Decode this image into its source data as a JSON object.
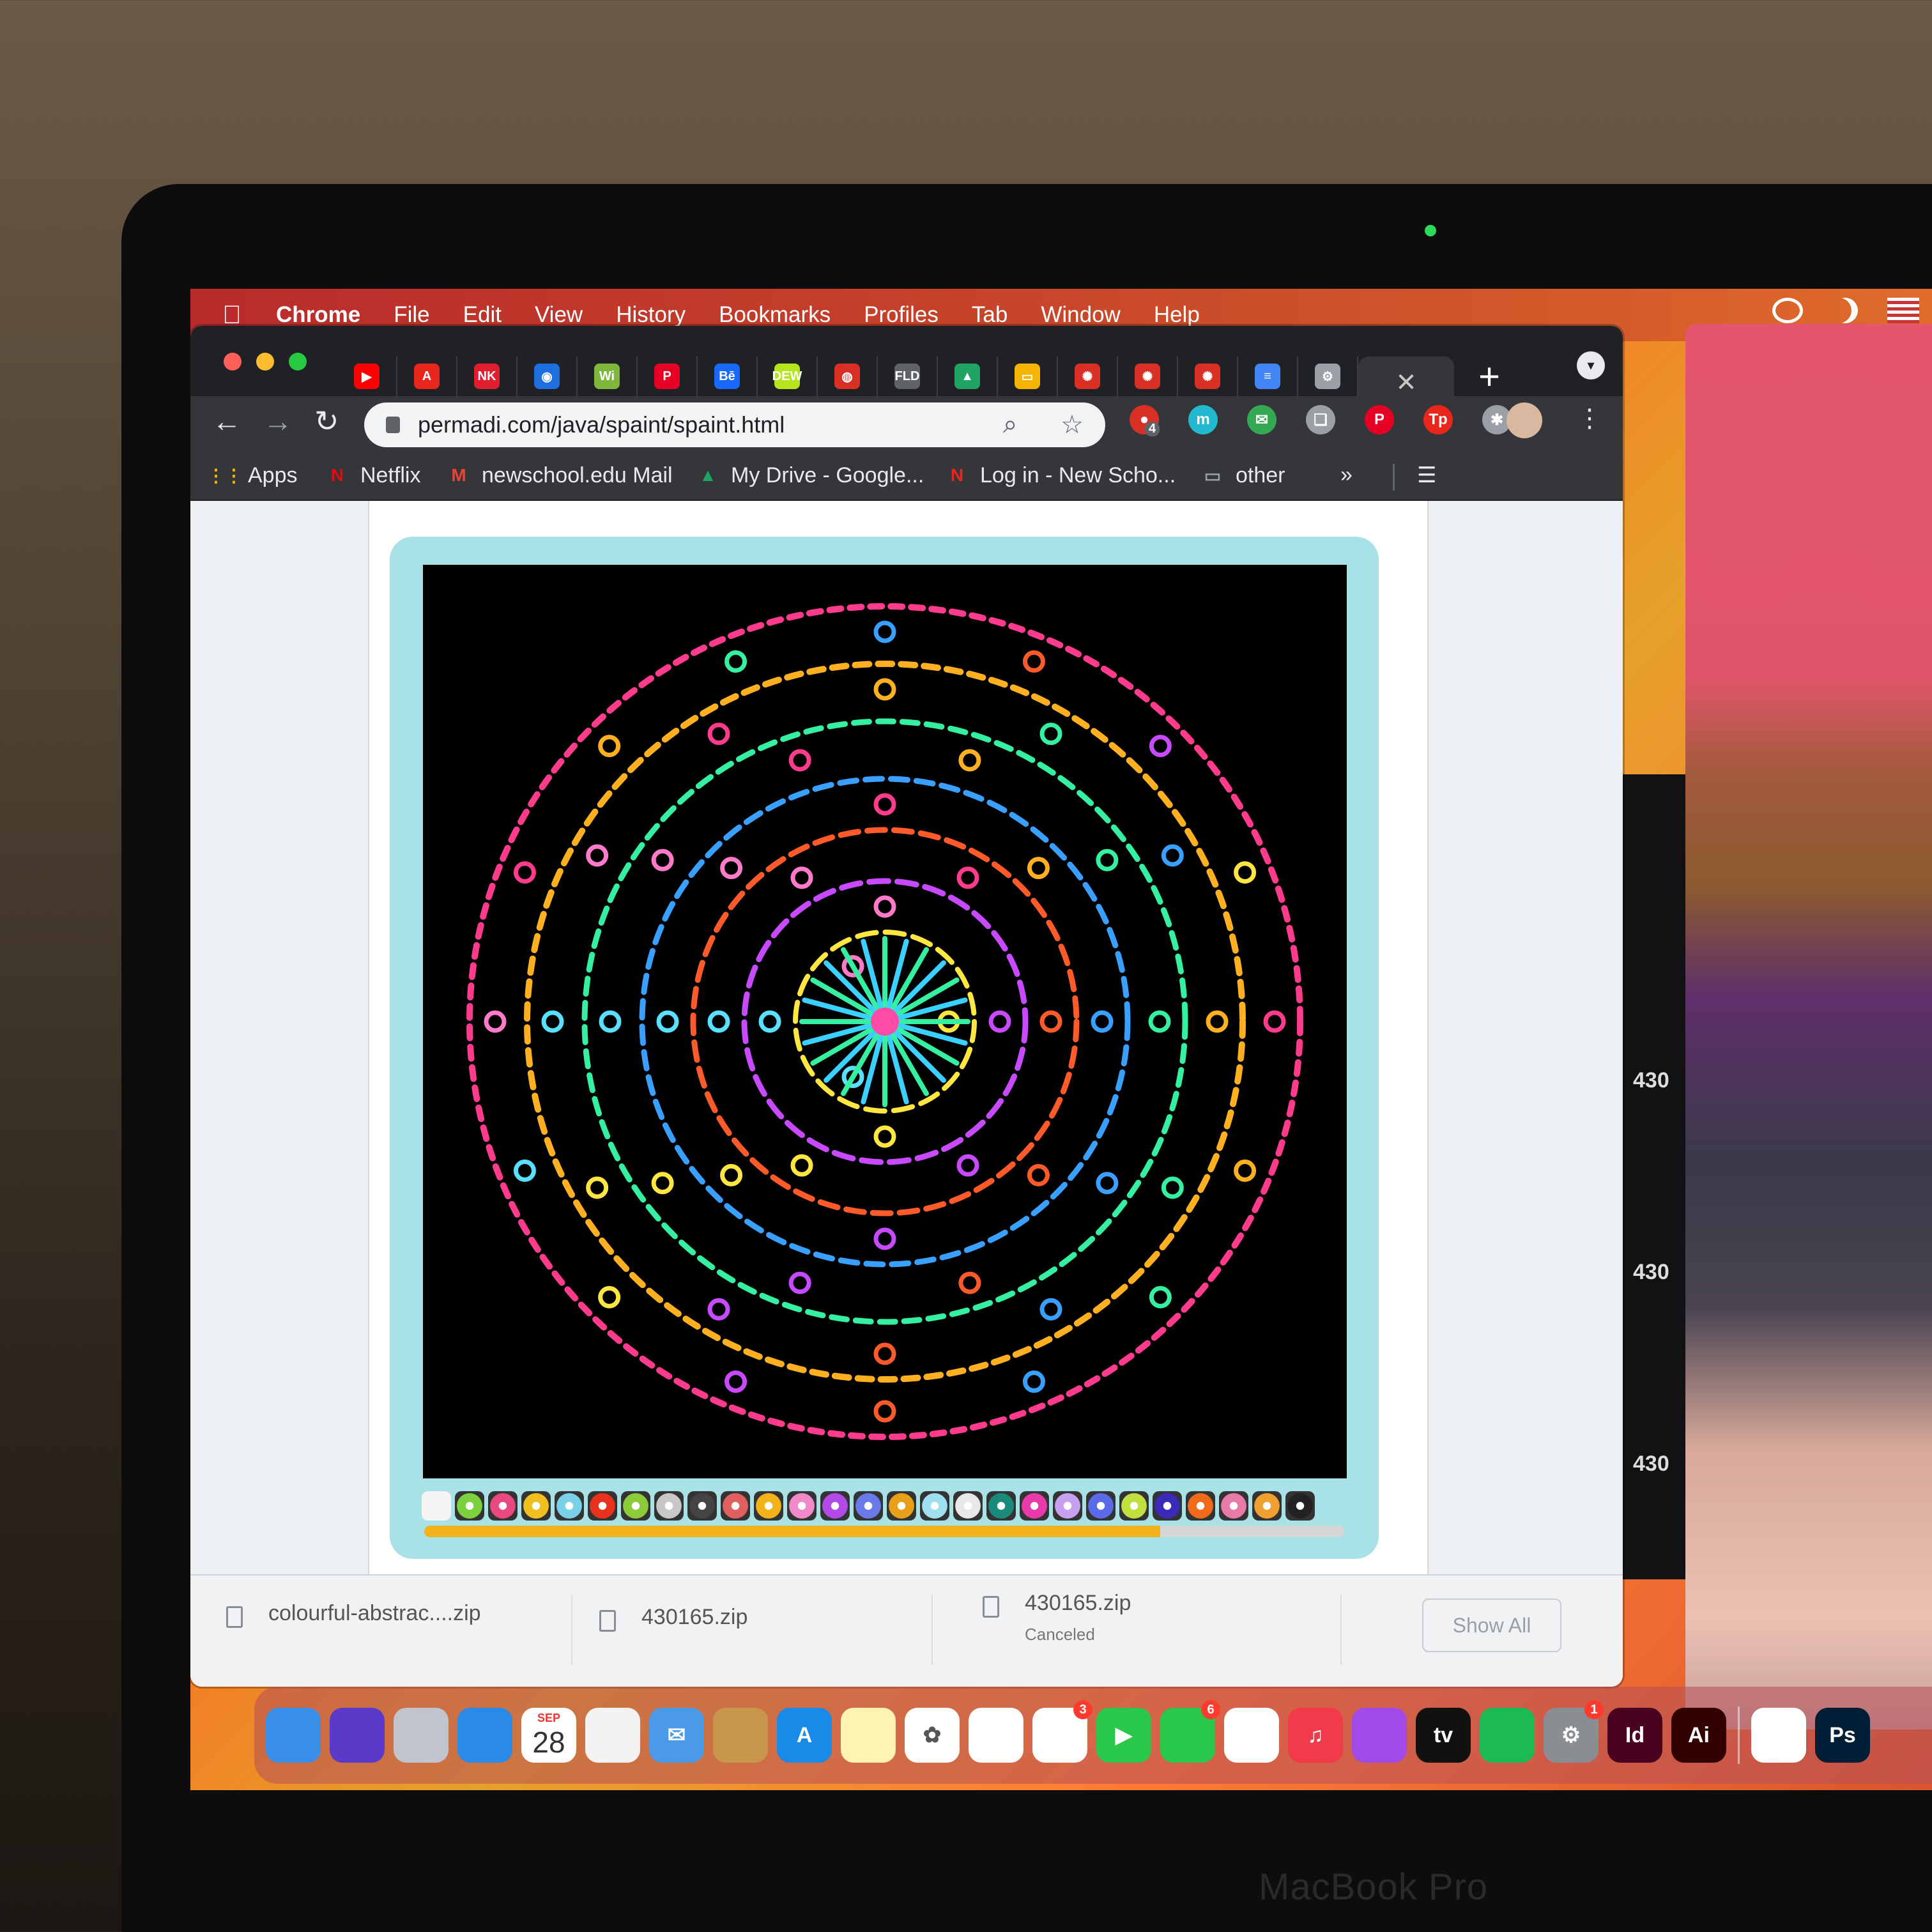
{
  "menubar": {
    "apple": "",
    "app_name": "Chrome",
    "items": [
      "File",
      "Edit",
      "View",
      "History",
      "Bookmarks",
      "Profiles",
      "Tab",
      "Window",
      "Help"
    ]
  },
  "tabs": {
    "favicons": [
      {
        "icon": "youtube-icon",
        "color": "#ff0000",
        "glyph": "▶"
      },
      {
        "icon": "adobe-icon",
        "color": "#e8261c",
        "glyph": "A"
      },
      {
        "icon": "nk-icon",
        "color": "#e01e2f",
        "glyph": "NK"
      },
      {
        "icon": "blue-circle-icon",
        "color": "#1d6fe0",
        "glyph": "◉"
      },
      {
        "icon": "wi-icon",
        "color": "#7fb63c",
        "glyph": "Wi"
      },
      {
        "icon": "pinterest-icon",
        "color": "#e60023",
        "glyph": "P"
      },
      {
        "icon": "behance-icon",
        "color": "#1769ff",
        "glyph": "Bē"
      },
      {
        "icon": "dew-icon",
        "color": "#b5e61d",
        "glyph": "DEW"
      },
      {
        "icon": "globe-icon",
        "color": "#d93025",
        "glyph": "◍"
      },
      {
        "icon": "fld-icon",
        "color": "#5f6368",
        "glyph": "FLD"
      },
      {
        "icon": "google-drive-icon",
        "color": "#1fa463",
        "glyph": "▲"
      },
      {
        "icon": "google-slides-icon",
        "color": "#f4b400",
        "glyph": "▭"
      },
      {
        "icon": "spiral-icon",
        "color": "#d93025",
        "glyph": "✺"
      },
      {
        "icon": "spiral-icon",
        "color": "#d93025",
        "glyph": "✺"
      },
      {
        "icon": "spiral-icon",
        "color": "#d93025",
        "glyph": "✺"
      },
      {
        "icon": "google-docs-icon",
        "color": "#4285f4",
        "glyph": "≡"
      },
      {
        "icon": "settings-icon",
        "color": "#9aa0a6",
        "glyph": "⚙"
      }
    ],
    "active_close": "✕",
    "new_tab": "+"
  },
  "toolbar": {
    "url": "permadi.com/java/spaint/spaint.html",
    "extension_badge": "4",
    "extensions": [
      {
        "icon": "extension-red-icon",
        "color": "#d93025",
        "glyph": "●"
      },
      {
        "icon": "extension-m-icon",
        "color": "#22b8cf",
        "glyph": "m"
      },
      {
        "icon": "extension-mail-icon",
        "color": "#34a853",
        "glyph": "✉"
      },
      {
        "icon": "extension-book-icon",
        "color": "#9aa0a6",
        "glyph": "❏"
      },
      {
        "icon": "pinterest-icon",
        "color": "#e60023",
        "glyph": "P"
      },
      {
        "icon": "extension-tp-icon",
        "color": "#e8261c",
        "glyph": "Tp"
      },
      {
        "icon": "puzzle-icon",
        "color": "#9aa0a6",
        "glyph": "✱"
      }
    ]
  },
  "bookmarks": [
    {
      "label": "Apps",
      "icon": "apps-grid-icon",
      "glyph": "⋮⋮",
      "color": "#f4b400"
    },
    {
      "label": "Netflix",
      "icon": "netflix-icon",
      "glyph": "N",
      "color": "#e50914"
    },
    {
      "label": "newschool.edu Mail",
      "icon": "gmail-icon",
      "glyph": "M",
      "color": "#ea4335"
    },
    {
      "label": "My Drive - Google...",
      "icon": "google-drive-icon",
      "glyph": "▲",
      "color": "#1fa463"
    },
    {
      "label": "Log in - New Scho...",
      "icon": "new-school-icon",
      "glyph": "N",
      "color": "#e8261c"
    },
    {
      "label": "other",
      "icon": "folder-icon",
      "glyph": "▭",
      "color": "#9aa0a6"
    }
  ],
  "bookmarks_overflow": "»",
  "palette": [
    "#f4f4f4",
    "#7bd23c",
    "#e84a7f",
    "#f0c020",
    "#7ad0e8",
    "#e8321e",
    "#8ccc3a",
    "#c8c8c8",
    "#444444",
    "#e06060",
    "#f2b31a",
    "#f08ac8",
    "#b24ae8",
    "#6a7ae8",
    "#e89f1a",
    "#9fe0f0",
    "#e8e8e8",
    "#1a8a7a",
    "#e83aa8",
    "#c8a0f0",
    "#5a6ae8",
    "#c0e040",
    "#3a2ab8",
    "#f06a1a",
    "#e87aa8",
    "#f0a030",
    "#222222"
  ],
  "progress": 0.8,
  "downloads": [
    {
      "name": "colourful-abstrac....zip",
      "status": ""
    },
    {
      "name": "430165.zip",
      "status": ""
    },
    {
      "name": "430165.zip",
      "status": "Canceled"
    }
  ],
  "show_all": "Show All",
  "side_labels": [
    "430",
    "430",
    "430"
  ],
  "dock": {
    "calendar_month": "SEP",
    "calendar_day": "28",
    "badges": {
      "reminders": "3",
      "messages": "6",
      "settings": "1"
    },
    "apps": [
      {
        "icon": "finder-icon",
        "color": "#3a8ee8",
        "glyph": ""
      },
      {
        "icon": "siri-icon",
        "color": "#5a3ac8",
        "glyph": ""
      },
      {
        "icon": "launchpad-icon",
        "color": "#c0c4cc",
        "glyph": ""
      },
      {
        "icon": "safari-icon",
        "color": "#2a8ae8",
        "glyph": ""
      },
      {
        "icon": "calendar-icon",
        "color": "#ffffff",
        "glyph": ""
      },
      {
        "icon": "chrome-icon",
        "color": "#f2f2f2",
        "glyph": ""
      },
      {
        "icon": "mail-icon",
        "color": "#4a9ae8",
        "glyph": "✉"
      },
      {
        "icon": "contacts-icon",
        "color": "#c8964a",
        "glyph": ""
      },
      {
        "icon": "app-store-icon",
        "color": "#1a8ae8",
        "glyph": "A"
      },
      {
        "icon": "notes-icon",
        "color": "#fff3b0",
        "glyph": ""
      },
      {
        "icon": "photos-icon",
        "color": "#ffffff",
        "glyph": "✿"
      },
      {
        "icon": "numbers-icon",
        "color": "#ffffff",
        "glyph": ""
      },
      {
        "icon": "reminders-icon",
        "color": "#ffffff",
        "glyph": ""
      },
      {
        "icon": "facetime-icon",
        "color": "#2ac84a",
        "glyph": "▶"
      },
      {
        "icon": "messages-icon",
        "color": "#2ac84a",
        "glyph": ""
      },
      {
        "icon": "news-icon",
        "color": "#ffffff",
        "glyph": ""
      },
      {
        "icon": "music-icon",
        "color": "#f23a4a",
        "glyph": "♫"
      },
      {
        "icon": "podcasts-icon",
        "color": "#a24ae8",
        "glyph": ""
      },
      {
        "icon": "apple-tv-icon",
        "color": "#111111",
        "glyph": "tv"
      },
      {
        "icon": "spotify-icon",
        "color": "#1db954",
        "glyph": ""
      },
      {
        "icon": "system-preferences-icon",
        "color": "#8a8d91",
        "glyph": "⚙"
      },
      {
        "icon": "indesign-icon",
        "color": "#49021f",
        "glyph": "Id"
      },
      {
        "icon": "illustrator-icon",
        "color": "#330000",
        "glyph": "Ai"
      },
      {
        "icon": "keynote-icon",
        "color": "#ffffff",
        "glyph": ""
      },
      {
        "icon": "photoshop-icon",
        "color": "#001e36",
        "glyph": "Ps"
      }
    ]
  }
}
